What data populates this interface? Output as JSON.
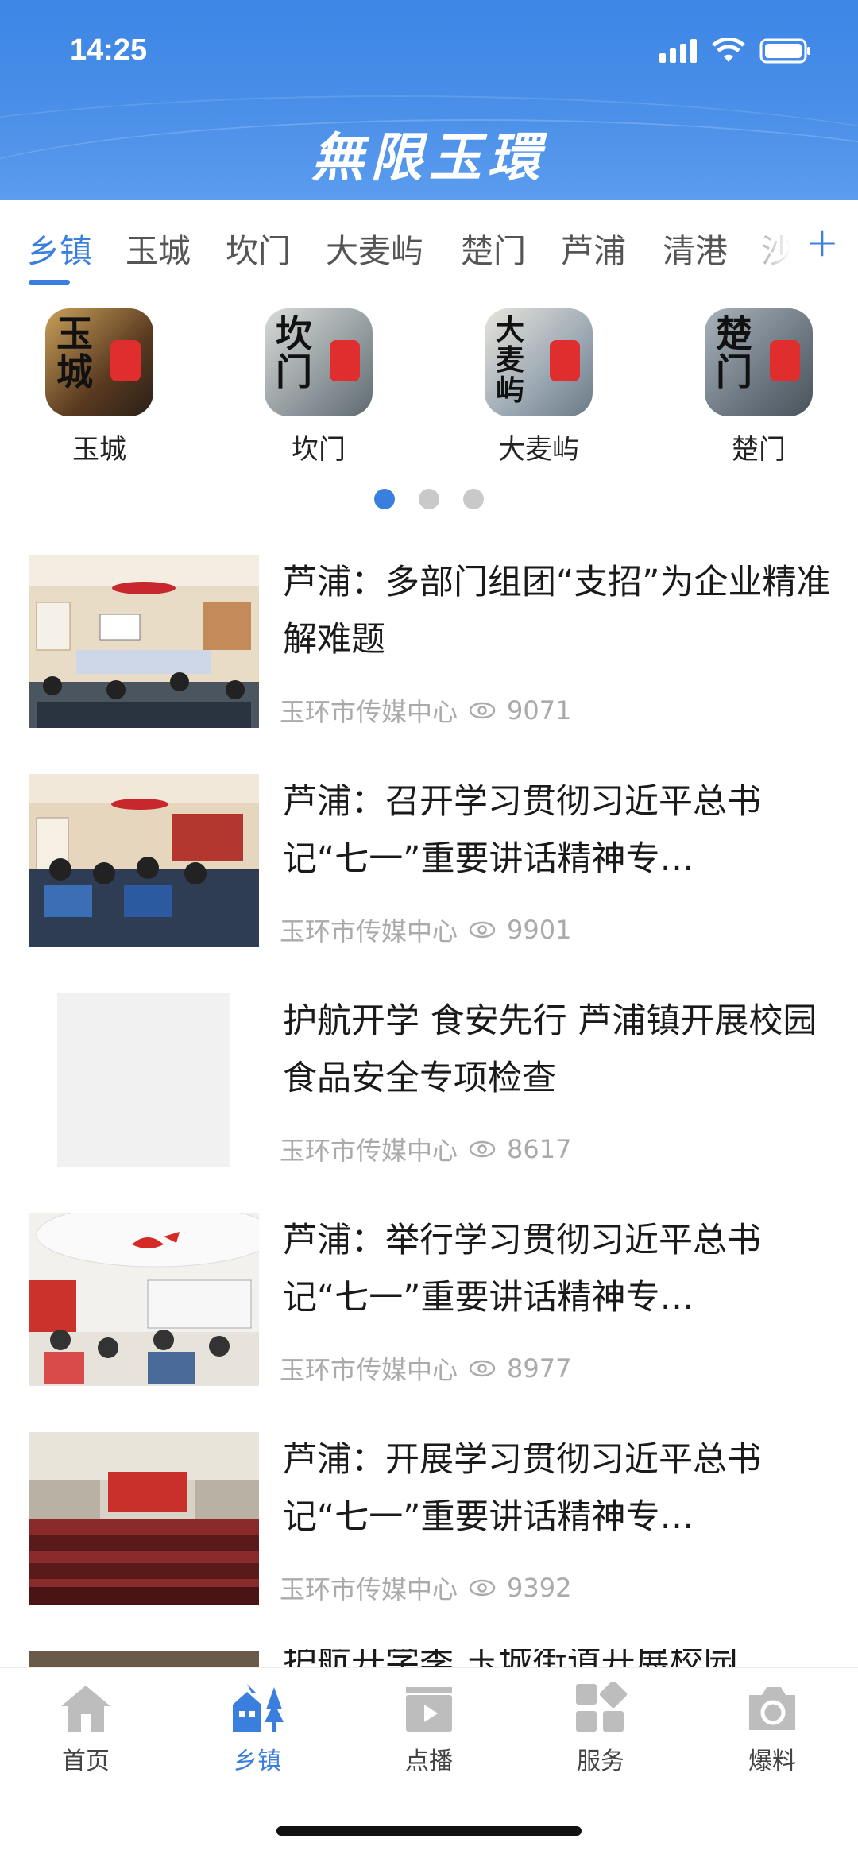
{
  "status": {
    "time": "14:25"
  },
  "header": {
    "title": "無限玉環"
  },
  "tabs": [
    "乡镇",
    "玉城",
    "坎门",
    "大麦屿",
    "楚门",
    "芦浦",
    "清港",
    "沙"
  ],
  "towns": [
    {
      "label": "玉城",
      "glyph": "玉城",
      "bg": "#8a6a3a"
    },
    {
      "label": "坎门",
      "glyph": "坎门",
      "bg": "#9aa3a8"
    },
    {
      "label": "大麦屿",
      "glyph": "大麦屿",
      "bg": "#7b8c9a"
    },
    {
      "label": "楚门",
      "glyph": "楚门",
      "bg": "#6b7680"
    }
  ],
  "news": [
    {
      "title": "芦浦：多部门组团“支招”为企业精准解难题",
      "source": "玉环市传媒中心",
      "views": "9071",
      "image": "meeting-room"
    },
    {
      "title": "芦浦：召开学习贯彻习近平总书记“七一”重要讲话精神专…",
      "source": "玉环市传媒中心",
      "views": "9901",
      "image": "meeting-room"
    },
    {
      "title": "护航开学 食安先行 芦浦镇开展校园食品安全专项检查",
      "source": "玉环市传媒中心",
      "views": "8617",
      "image": "blank"
    },
    {
      "title": "芦浦：举行学习贯彻习近平总书记“七一”重要讲话精神专…",
      "source": "玉环市传媒中心",
      "views": "8977",
      "image": "meeting-room"
    },
    {
      "title": "芦浦：开展学习贯彻习近平总书记“七一”重要讲话精神专…",
      "source": "玉环市传媒中心",
      "views": "9392",
      "image": "auditorium"
    },
    {
      "title": "护航开学季 玉城街道开展校园",
      "source": "",
      "views": "",
      "image": "partial"
    }
  ],
  "tabbar": [
    {
      "label": "首页",
      "icon": "home-icon"
    },
    {
      "label": "乡镇",
      "icon": "town-icon"
    },
    {
      "label": "点播",
      "icon": "video-icon"
    },
    {
      "label": "服务",
      "icon": "grid-icon"
    },
    {
      "label": "爆料",
      "icon": "camera-icon"
    }
  ],
  "colors": {
    "accent": "#3b7fde",
    "header": "#4a8fe8"
  }
}
